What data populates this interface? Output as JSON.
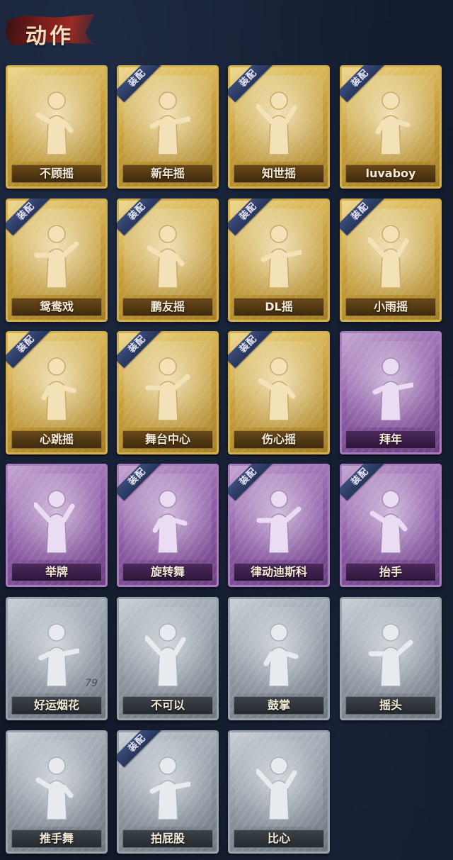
{
  "section_title": "动作",
  "equip_badge": "装配",
  "colors": {
    "gold": "#c9a13d",
    "purple": "#8e5fa6",
    "silver": "#8d969f",
    "badge": "#2f4170"
  },
  "actions": [
    {
      "name": "不顾摇",
      "rarity": "gold",
      "equipped": false,
      "icon": "dance-point-icon"
    },
    {
      "name": "新年摇",
      "rarity": "gold",
      "equipped": true,
      "icon": "dance-clap-icon"
    },
    {
      "name": "知世摇",
      "rarity": "gold",
      "equipped": true,
      "icon": "dance-sway-icon"
    },
    {
      "name": "luvaboy",
      "rarity": "gold",
      "equipped": true,
      "icon": "dance-cross-arms-icon"
    },
    {
      "name": "鸳鸯戏",
      "rarity": "gold",
      "equipped": true,
      "icon": "dance-arms-icon"
    },
    {
      "name": "鹏友摇",
      "rarity": "gold",
      "equipped": true,
      "icon": "dance-shrug-icon"
    },
    {
      "name": "DL摇",
      "rarity": "gold",
      "equipped": true,
      "icon": "dance-raise-arm-icon"
    },
    {
      "name": "小雨摇",
      "rarity": "gold",
      "equipped": true,
      "icon": "dance-fold-arms-icon"
    },
    {
      "name": "心跳摇",
      "rarity": "gold",
      "equipped": true,
      "icon": "dance-heartbeat-icon"
    },
    {
      "name": "舞台中心",
      "rarity": "gold",
      "equipped": true,
      "icon": "dance-spotlight-icon"
    },
    {
      "name": "伤心摇",
      "rarity": "gold",
      "equipped": true,
      "icon": "dance-heart-hands-icon"
    },
    {
      "name": "拜年",
      "rarity": "purple",
      "equipped": false,
      "icon": "new-year-bow-icon"
    },
    {
      "name": "举牌",
      "rarity": "purple",
      "equipped": false,
      "icon": "hold-sign-icon"
    },
    {
      "name": "旋转舞",
      "rarity": "purple",
      "equipped": true,
      "icon": "spin-dance-icon"
    },
    {
      "name": "律动迪斯科",
      "rarity": "purple",
      "equipped": true,
      "icon": "disco-icon"
    },
    {
      "name": "抬手",
      "rarity": "purple",
      "equipped": true,
      "icon": "raise-hand-icon"
    },
    {
      "name": "好运烟花",
      "rarity": "silver",
      "equipped": false,
      "icon": "firework-icon",
      "count": "79"
    },
    {
      "name": "不可以",
      "rarity": "silver",
      "equipped": false,
      "icon": "finger-wag-icon"
    },
    {
      "name": "鼓掌",
      "rarity": "silver",
      "equipped": false,
      "icon": "clap-icon"
    },
    {
      "name": "摇头",
      "rarity": "silver",
      "equipped": false,
      "icon": "head-shake-icon"
    },
    {
      "name": "推手舞",
      "rarity": "silver",
      "equipped": false,
      "icon": "push-dance-icon"
    },
    {
      "name": "拍屁股",
      "rarity": "silver",
      "equipped": true,
      "icon": "slap-butt-icon"
    },
    {
      "name": "比心",
      "rarity": "silver",
      "equipped": false,
      "icon": "finger-heart-icon"
    }
  ]
}
